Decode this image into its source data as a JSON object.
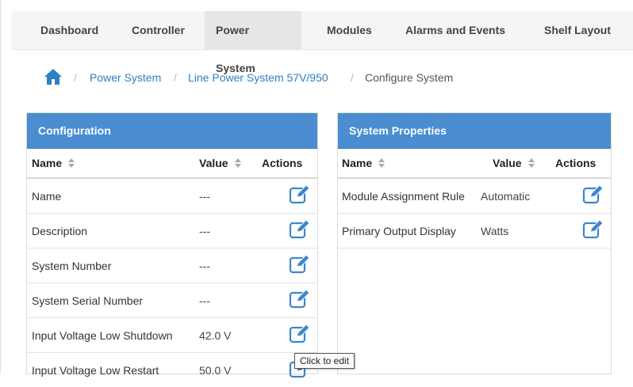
{
  "nav": {
    "tabs": [
      {
        "label": "Dashboard"
      },
      {
        "label": "Controller"
      },
      {
        "label": "Power System",
        "active": true
      },
      {
        "label": "Modules"
      },
      {
        "label": "Alarms and Events"
      },
      {
        "label": "Shelf Layout"
      }
    ]
  },
  "breadcrumb": {
    "home_icon": "home-icon",
    "separator": "/",
    "items": [
      "Power System",
      "Line Power System 57V/950",
      "Configure System"
    ]
  },
  "configuration": {
    "title": "Configuration",
    "columns": {
      "name": "Name",
      "value": "Value",
      "actions": "Actions"
    },
    "rows": [
      {
        "name": "Name",
        "value": "---"
      },
      {
        "name": "Description",
        "value": "---"
      },
      {
        "name": "System Number",
        "value": "---"
      },
      {
        "name": "System Serial Number",
        "value": "---"
      },
      {
        "name": "Input Voltage Low Shutdown",
        "value": "42.0 V"
      },
      {
        "name": "Input Voltage Low Restart",
        "value": "50.0 V"
      }
    ]
  },
  "system_properties": {
    "title": "System Properties",
    "columns": {
      "name": "Name",
      "value": "Value",
      "actions": "Actions"
    },
    "rows": [
      {
        "name": "Module Assignment Rule",
        "value": "Automatic"
      },
      {
        "name": "Primary Output Display",
        "value": "Watts"
      }
    ]
  },
  "tooltip": {
    "text": "Click to edit"
  },
  "icons": {
    "edit": "edit-icon",
    "sort": "sort-icon"
  },
  "colors": {
    "accent": "#4a8ed1",
    "link": "#2f7fc1",
    "nav_bg": "#f5f5f5",
    "nav_active": "#e6e6e6"
  }
}
